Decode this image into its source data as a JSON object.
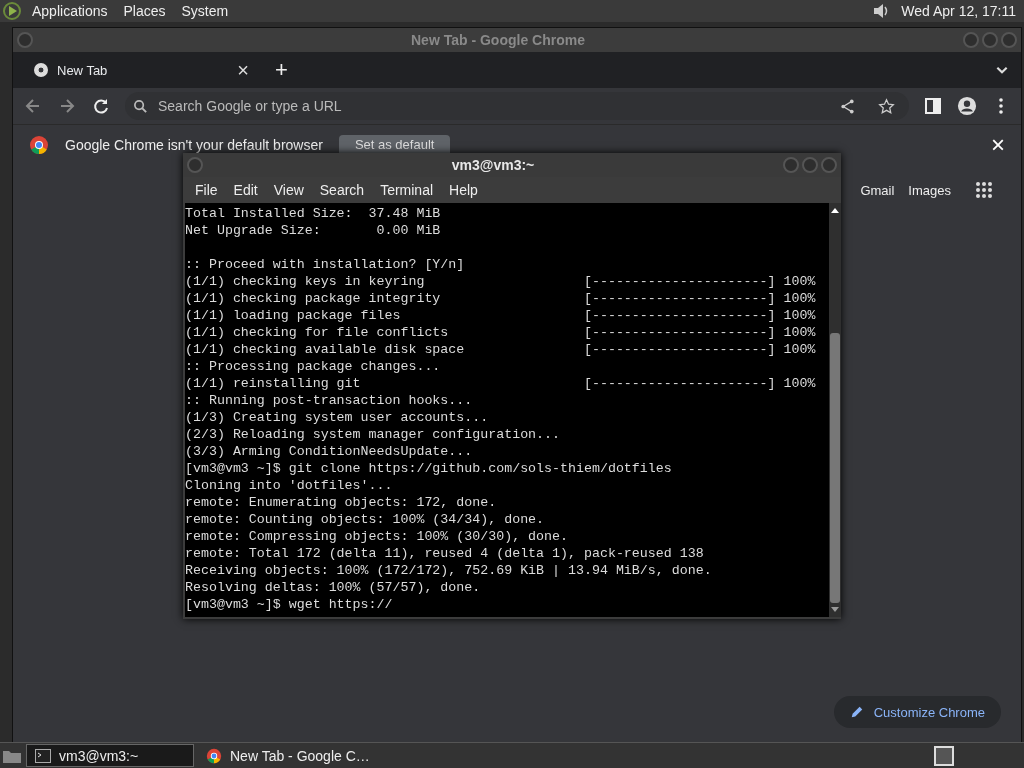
{
  "top_panel": {
    "menus": [
      "Applications",
      "Places",
      "System"
    ],
    "clock": "Wed Apr 12, 17:11"
  },
  "browser": {
    "title": "New Tab - Google Chrome",
    "tabs": [
      {
        "label": "New Tab",
        "close": "×",
        "selected": true
      }
    ],
    "new_tab": "+",
    "address_bar": {
      "placeholder": "Search Google or type a URL"
    },
    "infobar": {
      "message": "Google Chrome isn't your default browser",
      "button": "Set as default",
      "close": "×"
    },
    "links": [
      "Gmail",
      "Images"
    ],
    "customize": "Customize Chrome"
  },
  "terminal": {
    "title": "vm3@vm3:~",
    "menus": [
      "File",
      "Edit",
      "View",
      "Search",
      "Terminal",
      "Help"
    ],
    "blocks": [
      [
        "Total Installed Size:  37.48 MiB",
        "Net Upgrade Size:       0.00 MiB"
      ],
      [
        ":: Proceed with installation? [Y/n]",
        "(1/1) checking keys in keyring                    [----------------------] 100%",
        "(1/1) checking package integrity                  [----------------------] 100%",
        "(1/1) loading package files                       [----------------------] 100%",
        "(1/1) checking for file conflicts                 [----------------------] 100%",
        "(1/1) checking available disk space               [----------------------] 100%",
        ":: Processing package changes...",
        "(1/1) reinstalling git                            [----------------------] 100%",
        ":: Running post-transaction hooks...",
        "(1/3) Creating system user accounts...",
        "(2/3) Reloading system manager configuration...",
        "(3/3) Arming ConditionNeedsUpdate...",
        "[vm3@vm3 ~]$ git clone https://github.com/sols-thiem/dotfiles",
        "Cloning into 'dotfiles'...",
        "remote: Enumerating objects: 172, done.",
        "remote: Counting objects: 100% (34/34), done.",
        "remote: Compressing objects: 100% (30/30), done.",
        "remote: Total 172 (delta 11), reused 4 (delta 1), pack-reused 138",
        "Receiving objects: 100% (172/172), 752.69 KiB | 13.94 MiB/s, done.",
        "Resolving deltas: 100% (57/57), done.",
        "[vm3@vm3 ~]$ wget https://"
      ]
    ]
  },
  "taskbar": {
    "items": [
      {
        "kind": "terminal",
        "label": "vm3@vm3:~",
        "selected": true
      },
      {
        "kind": "browser",
        "label": "New Tab - Google C…",
        "selected": false
      }
    ]
  }
}
